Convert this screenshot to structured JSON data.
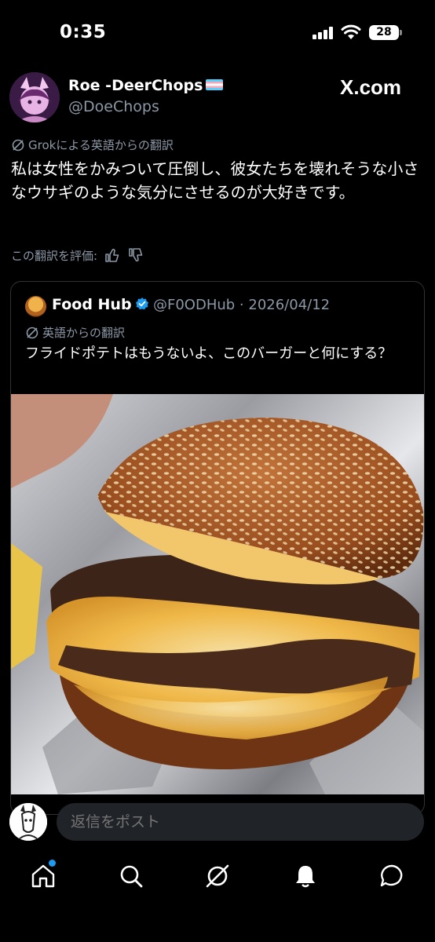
{
  "status": {
    "time": "0:35",
    "battery": "28"
  },
  "post": {
    "display_name": "Roe -DeerChops",
    "handle": "@DoeChops",
    "site_label": "X.com",
    "translation_note": "Grokによる英語からの翻訳",
    "text": "私は女性をかみついて圧倒し、彼女たちを壊れそうな小さなウサギのような気分にさせるのが大好きです。",
    "rate_label": "この翻訳を評価:"
  },
  "quote": {
    "name": "Food Hub",
    "handle_date": "@F0ODHub · 2026/04/12",
    "translation_note": "英語からの翻訳",
    "text": "フライドポテトはもうないよ、このバーガーと何にする？"
  },
  "reply": {
    "placeholder": "返信をポスト"
  },
  "tabs": [
    "home-icon",
    "search-icon",
    "grok-icon",
    "notifications-icon",
    "messages-icon"
  ],
  "colors": {
    "background": "#000000",
    "accent": "#1d9bf0",
    "muted": "#8b98a5"
  }
}
